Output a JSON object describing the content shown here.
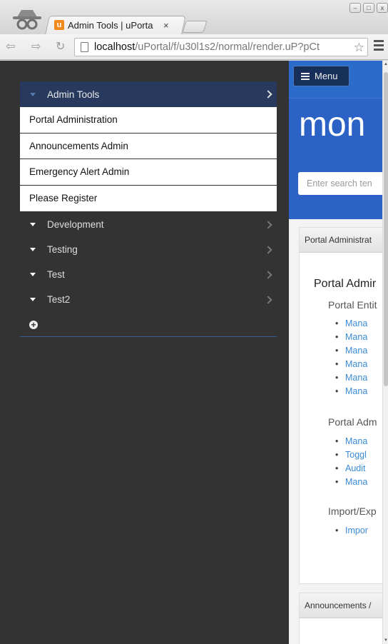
{
  "browser": {
    "tab_title": "Admin Tools | uPorta",
    "tab_close": "×",
    "favicon_letter": "u",
    "url_host": "localhost",
    "url_path": "/uPortal/f/u30l1s2/normal/render.uP?pCt",
    "back_icon": "⇦",
    "forward_icon": "⇨",
    "reload_icon": "↻",
    "star_icon": "☆",
    "win_min": "–",
    "win_max": "□",
    "win_close": "x"
  },
  "sidebar": {
    "active_group": "Admin Tools",
    "flyout_items": [
      "Portal Administration",
      "Announcements Admin",
      "Emergency Alert Admin",
      "Please Register"
    ],
    "groups": [
      "Development",
      "Testing",
      "Test",
      "Test2"
    ],
    "add_icon": "+"
  },
  "content": {
    "menu_label": "Menu",
    "brand_text": "mon",
    "search_placeholder": "Enter search ten",
    "portlets": [
      {
        "header": "Portal Administrat",
        "title": "Portal Admir",
        "sections": [
          {
            "label": "Portal Entit",
            "links": [
              "Mana",
              "Mana",
              "Mana",
              "Mana",
              "Mana",
              "Mana"
            ]
          },
          {
            "label": "Portal Adm",
            "links": [
              "Mana",
              "Toggl",
              "Audit",
              "Mana"
            ]
          },
          {
            "label": "Import/Exp",
            "links": [
              "Impor"
            ]
          }
        ]
      },
      {
        "header": "Announcements /"
      }
    ]
  }
}
